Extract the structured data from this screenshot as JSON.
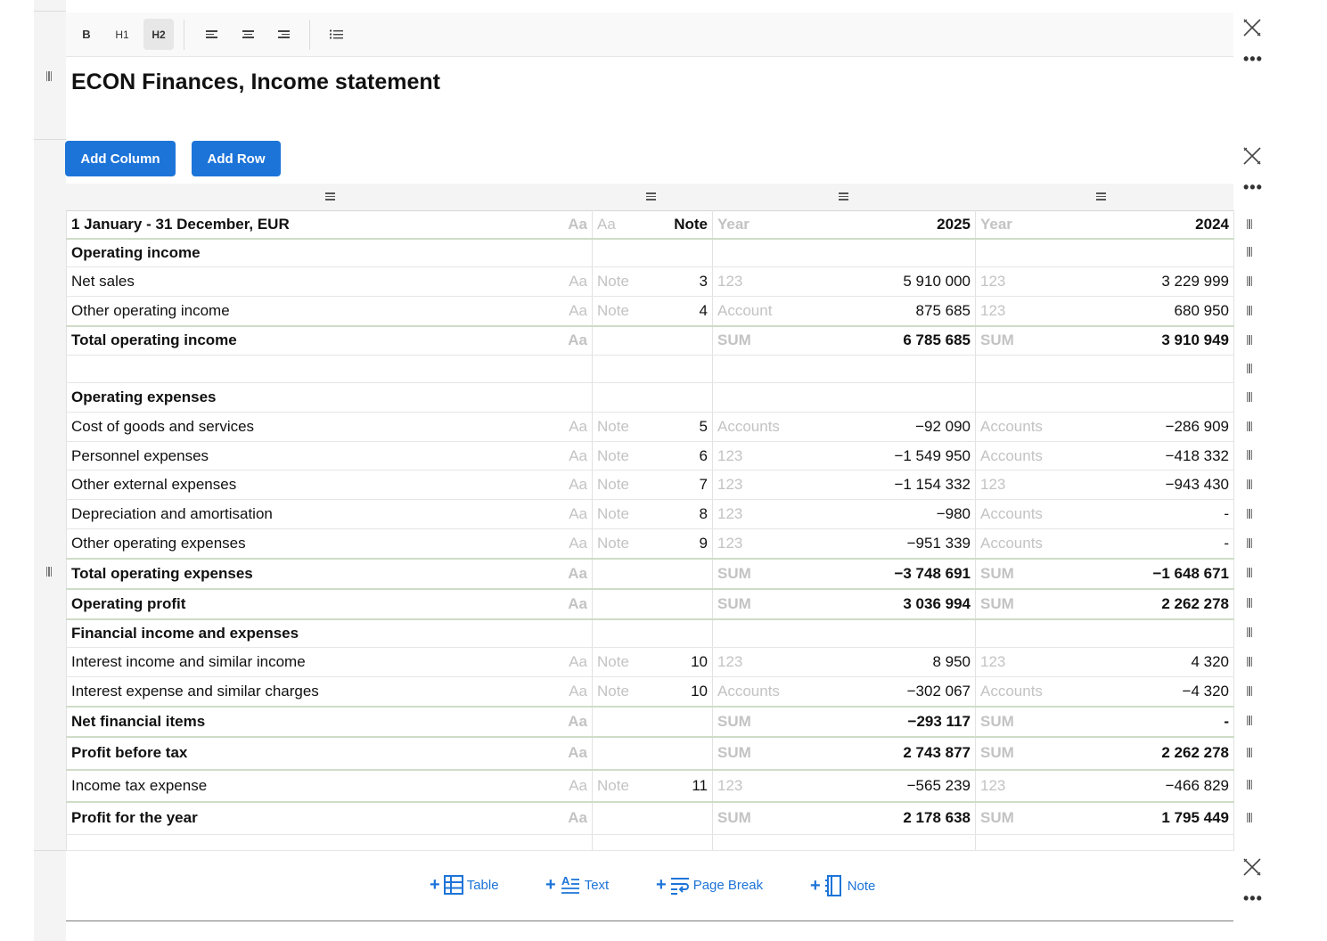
{
  "toolbar": {
    "bold_label": "B",
    "h1_label": "H1",
    "h2_label": "H2"
  },
  "icons": {
    "align_left": "align-left-icon",
    "align_center": "align-center-icon",
    "align_right": "align-right-icon",
    "list": "list-icon",
    "delete": "delete-block-icon",
    "more": "more-options-icon",
    "drag": "drag-handle-icon"
  },
  "colors": {
    "accent": "#1d74d8",
    "muted_text": "#c3c3c3",
    "row_total_border": "#cfdcc7"
  },
  "block": {
    "title": "ECON Finances, Income statement",
    "more_label": "•••"
  },
  "buttons": {
    "add_column": "Add Column",
    "add_row": "Add Row"
  },
  "table": {
    "rows": [
      {
        "label": "1 January - 31 December, EUR",
        "type": "Aa",
        "notetype": "Aa",
        "note": "Note",
        "t25": "Year",
        "v25": "2025",
        "t24": "Year",
        "v24": "2024",
        "bold": true,
        "strong": true
      },
      {
        "label": "Operating income",
        "type": "",
        "notetype": "",
        "note": "",
        "t25": "",
        "v25": "",
        "t24": "",
        "v24": "",
        "bold": true
      },
      {
        "label": "Net sales",
        "type": "Aa",
        "notetype": "Note",
        "note": "3",
        "t25": "123",
        "v25": "5 910 000",
        "t24": "123",
        "v24": "3 229 999"
      },
      {
        "label": "Other operating income",
        "type": "Aa",
        "notetype": "Note",
        "note": "4",
        "t25": "Account",
        "v25": "875 685",
        "t24": "123",
        "v24": "680 950",
        "strong": true
      },
      {
        "label": "Total operating income",
        "type": "Aa",
        "notetype": "",
        "note": "",
        "t25": "SUM",
        "v25": "6 785 685",
        "t24": "SUM",
        "v24": "3 910 949",
        "bold": true
      },
      {
        "label": "",
        "type": "",
        "notetype": "",
        "note": "",
        "t25": "",
        "v25": "",
        "t24": "",
        "v24": ""
      },
      {
        "label": "Operating expenses",
        "type": "",
        "notetype": "",
        "note": "",
        "t25": "",
        "v25": "",
        "t24": "",
        "v24": "",
        "bold": true
      },
      {
        "label": "Cost of goods and services",
        "type": "Aa",
        "notetype": "Note",
        "note": "5",
        "t25": "Accounts",
        "v25": "−92 090",
        "t24": "Accounts",
        "v24": "−286 909"
      },
      {
        "label": "Personnel expenses",
        "type": "Aa",
        "notetype": "Note",
        "note": "6",
        "t25": "123",
        "v25": "−1 549 950",
        "t24": "Accounts",
        "v24": "−418 332"
      },
      {
        "label": "Other external expenses",
        "type": "Aa",
        "notetype": "Note",
        "note": "7",
        "t25": "123",
        "v25": "−1 154 332",
        "t24": "123",
        "v24": "−943 430"
      },
      {
        "label": "Depreciation and amortisation",
        "type": "Aa",
        "notetype": "Note",
        "note": "8",
        "t25": "123",
        "v25": "−980",
        "t24": "Accounts",
        "v24": "-"
      },
      {
        "label": "Other operating expenses",
        "type": "Aa",
        "notetype": "Note",
        "note": "9",
        "t25": "123",
        "v25": "−951 339",
        "t24": "Accounts",
        "v24": "-",
        "strong": true
      },
      {
        "label": "Total operating expenses",
        "type": "Aa",
        "notetype": "",
        "note": "",
        "t25": "SUM",
        "v25": "−3 748 691",
        "t24": "SUM",
        "v24": "−1 648 671",
        "bold": true,
        "strong": true
      },
      {
        "label": "Operating profit",
        "type": "Aa",
        "notetype": "",
        "note": "",
        "t25": "SUM",
        "v25": "3 036 994",
        "t24": "SUM",
        "v24": "2 262 278",
        "bold": true,
        "strong": true
      },
      {
        "label": "Financial income and expenses",
        "type": "",
        "notetype": "",
        "note": "",
        "t25": "",
        "v25": "",
        "t24": "",
        "v24": "",
        "bold": true
      },
      {
        "label": "Interest income and similar income",
        "type": "Aa",
        "notetype": "Note",
        "note": "10",
        "t25": "123",
        "v25": "8 950",
        "t24": "123",
        "v24": "4 320"
      },
      {
        "label": "Interest expense and similar charges",
        "type": "Aa",
        "notetype": "Note",
        "note": "10",
        "t25": "Accounts",
        "v25": "−302 067",
        "t24": "Accounts",
        "v24": "−4 320",
        "strong": true
      },
      {
        "label": "Net financial items",
        "type": "Aa",
        "notetype": "",
        "note": "",
        "t25": "SUM",
        "v25": "−293 117",
        "t24": "SUM",
        "v24": "-",
        "bold": true,
        "strong": true
      },
      {
        "label": "Profit before tax",
        "type": "Aa",
        "notetype": "",
        "note": "",
        "t25": "SUM",
        "v25": "2 743 877",
        "t24": "SUM",
        "v24": "2 262 278",
        "bold": true,
        "strong": true
      },
      {
        "label": "Income tax expense",
        "type": "Aa",
        "notetype": "Note",
        "note": "11",
        "t25": "123",
        "v25": "−565 239",
        "t24": "123",
        "v24": "−466 829",
        "strong": true
      },
      {
        "label": "Profit for the year",
        "type": "Aa",
        "notetype": "",
        "note": "",
        "t25": "SUM",
        "v25": "2 178 638",
        "t24": "SUM",
        "v24": "1 795 449",
        "bold": true
      },
      {
        "label": "",
        "type": "",
        "notetype": "",
        "note": "",
        "t25": "",
        "v25": "",
        "t24": "",
        "v24": ""
      }
    ]
  },
  "insert_bar": {
    "table_label": "Table",
    "text_label": "Text",
    "page_break_label": "Page Break",
    "note_label": "Note",
    "plus": "+"
  }
}
